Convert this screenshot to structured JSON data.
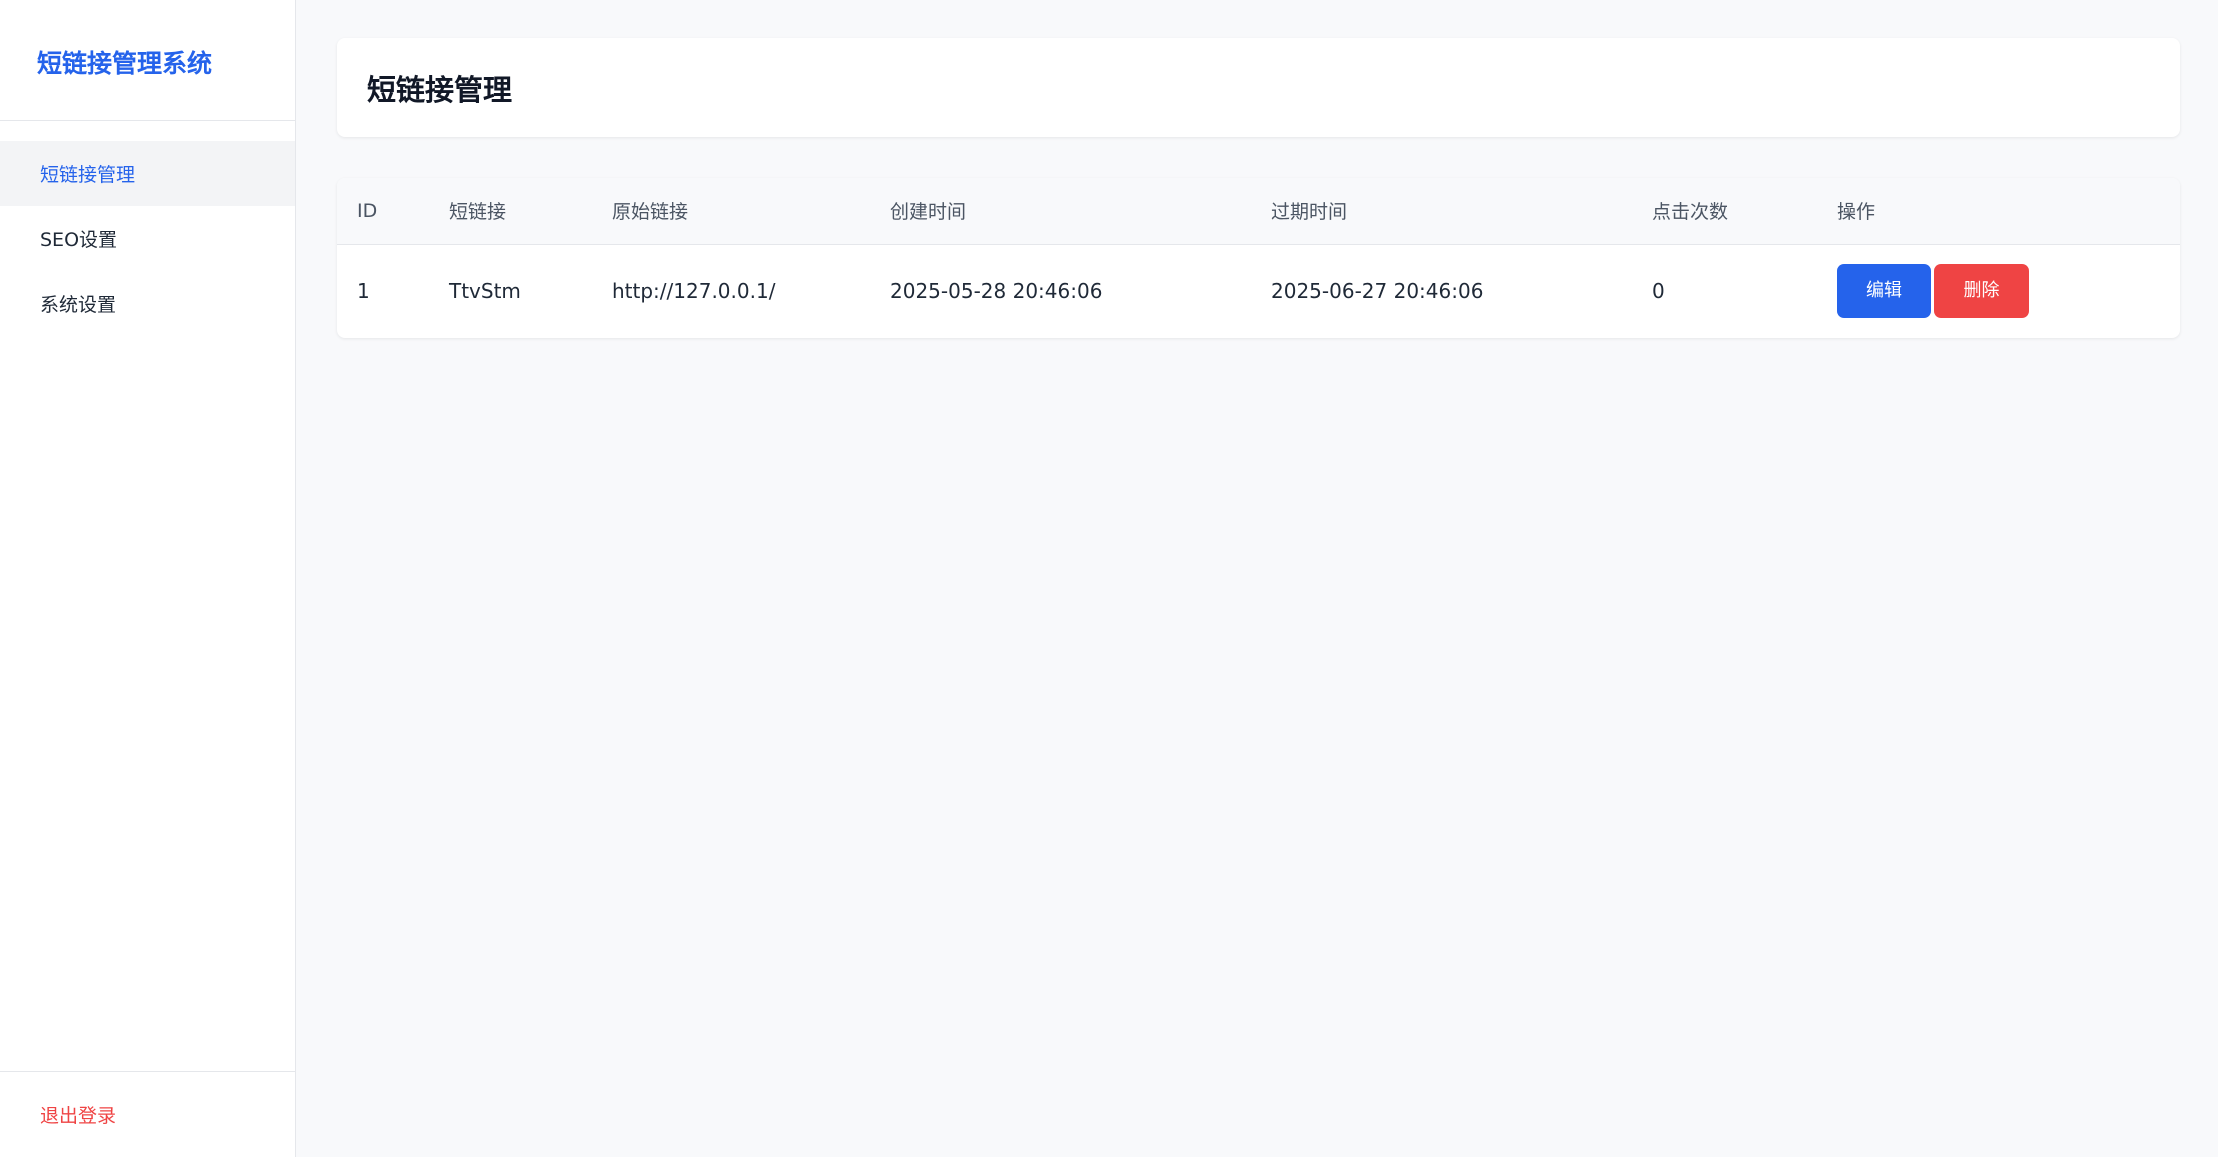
{
  "sidebar": {
    "brand": "短链接管理系统",
    "items": [
      {
        "label": "短链接管理",
        "active": true
      },
      {
        "label": "SEO设置",
        "active": false
      },
      {
        "label": "系统设置",
        "active": false
      }
    ],
    "logout_label": "退出登录"
  },
  "main": {
    "title": "短链接管理",
    "table": {
      "headers": [
        "ID",
        "短链接",
        "原始链接",
        "创建时间",
        "过期时间",
        "点击次数",
        "操作"
      ],
      "rows": [
        {
          "id": "1",
          "short": "TtvStm",
          "original": "http://127.0.0.1/",
          "created": "2025-05-28 20:46:06",
          "expire": "2025-06-27 20:46:06",
          "clicks": "0",
          "edit_label": "编辑",
          "delete_label": "删除"
        }
      ]
    }
  },
  "colors": {
    "primary": "#2563eb",
    "danger": "#ef4444",
    "background": "#f8f9fb"
  }
}
